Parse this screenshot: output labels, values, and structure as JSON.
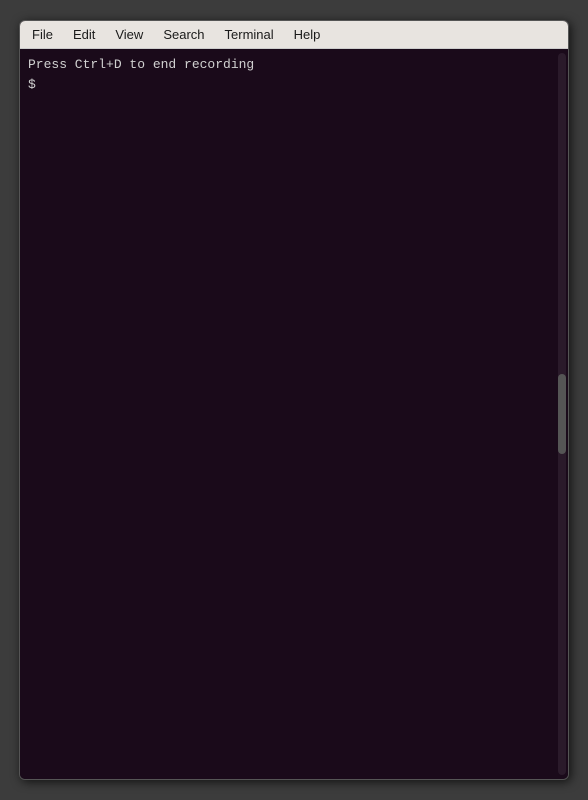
{
  "menubar": {
    "items": [
      {
        "label": "File",
        "id": "file"
      },
      {
        "label": "Edit",
        "id": "edit"
      },
      {
        "label": "View",
        "id": "view"
      },
      {
        "label": "Search",
        "id": "search"
      },
      {
        "label": "Terminal",
        "id": "terminal"
      },
      {
        "label": "Help",
        "id": "help"
      }
    ]
  },
  "terminal": {
    "line1": "Press Ctrl+D to end recording",
    "line2": "$",
    "bg_color": "#1a0a1a",
    "text_color": "#d0d0d0"
  }
}
